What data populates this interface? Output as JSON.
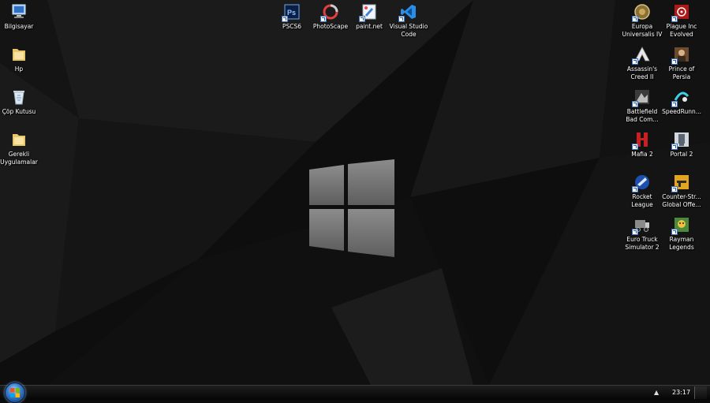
{
  "desktop": {
    "left_icons": [
      {
        "label": "Bilgisayar",
        "icon": "computer-icon"
      },
      {
        "label": "Hp",
        "icon": "folder-icon"
      },
      {
        "label": "Çöp Kutusu",
        "icon": "recycle-bin-icon"
      },
      {
        "label": "Gerekli\nUygulamalar",
        "icon": "folder-icon"
      }
    ],
    "top_icons": [
      {
        "label": "PSCS6",
        "icon": "photoshop-icon"
      },
      {
        "label": "PhotoScape",
        "icon": "photoscape-icon"
      },
      {
        "label": "paint.net",
        "icon": "paintnet-icon"
      },
      {
        "label": "Visual Studio\nCode",
        "icon": "vscode-icon"
      }
    ],
    "right_icons": [
      {
        "label": "Europa\nUniversalis IV",
        "icon": "europa-universalis-icon"
      },
      {
        "label": "Plague Inc\nEvolved",
        "icon": "plague-inc-icon"
      },
      {
        "label": "Assassin's\nCreed II",
        "icon": "assassins-creed-icon"
      },
      {
        "label": "Prince of\nPersia",
        "icon": "prince-of-persia-icon"
      },
      {
        "label": "Battlefield\nBad Com...",
        "icon": "battlefield-icon"
      },
      {
        "label": "SpeedRunn...",
        "icon": "speedrunners-icon"
      },
      {
        "label": "Mafia 2",
        "icon": "mafia-icon"
      },
      {
        "label": "Portal 2",
        "icon": "portal-icon"
      },
      {
        "label": "Rocket\nLeague",
        "icon": "rocket-league-icon"
      },
      {
        "label": "Counter-Str...\nGlobal Offe...",
        "icon": "csgo-icon"
      },
      {
        "label": "Euro Truck\nSimulator 2",
        "icon": "euro-truck-icon"
      },
      {
        "label": "Rayman\nLegends",
        "icon": "rayman-icon"
      }
    ]
  },
  "taskbar": {
    "clock": "23:17",
    "tray_arrow": "▲"
  },
  "colors": {
    "background": "#0c0c0c",
    "taskbar": "#111111",
    "logo": "#8a8a8a"
  }
}
